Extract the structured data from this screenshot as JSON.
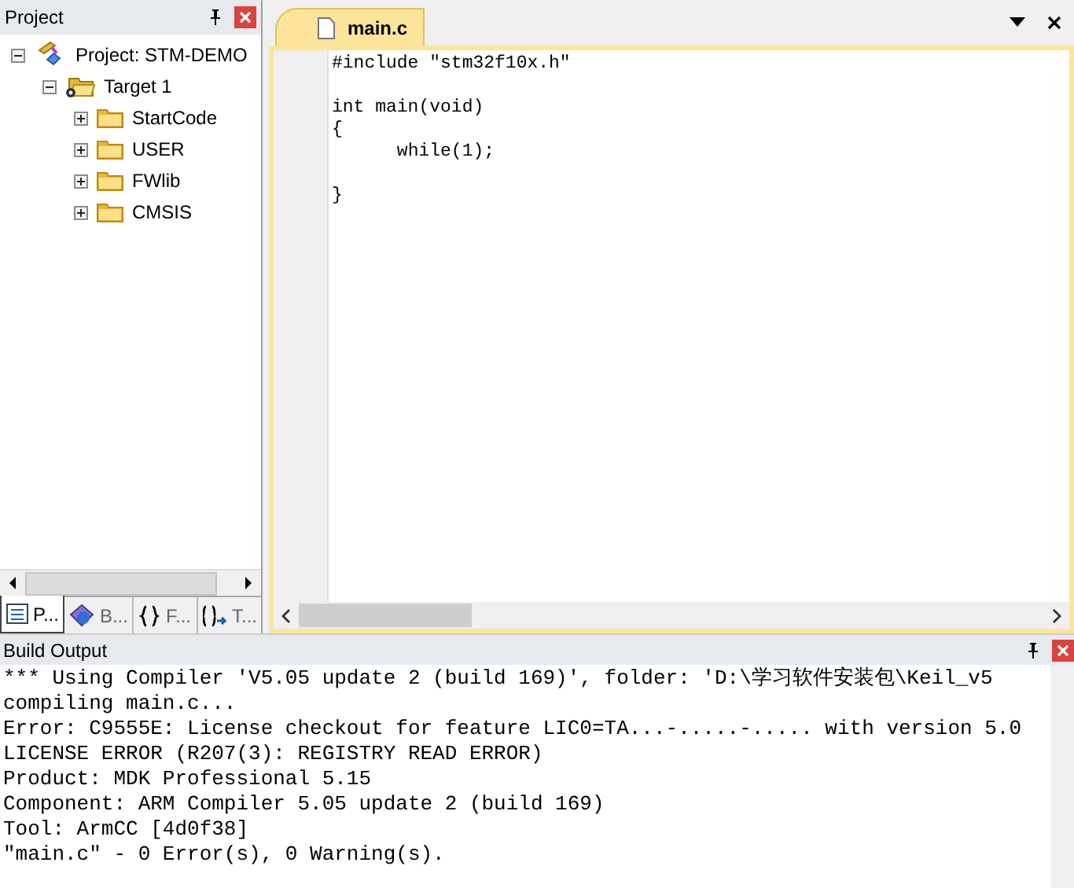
{
  "project_panel": {
    "title": "Project",
    "tree": [
      {
        "label": "Project: STM-DEMO",
        "kind": "project",
        "expanded": true,
        "children": [
          {
            "label": "Target 1",
            "kind": "target",
            "expanded": true,
            "children": [
              {
                "label": "StartCode",
                "kind": "folder",
                "expanded": false
              },
              {
                "label": "USER",
                "kind": "folder",
                "expanded": false
              },
              {
                "label": "FWlib",
                "kind": "folder",
                "expanded": false
              },
              {
                "label": "CMSIS",
                "kind": "folder",
                "expanded": false
              }
            ]
          }
        ]
      }
    ],
    "tabs": [
      {
        "label": "P...",
        "kind": "project",
        "selected": true
      },
      {
        "label": "B...",
        "kind": "books",
        "selected": false
      },
      {
        "label": "F...",
        "kind": "functions",
        "selected": false
      },
      {
        "label": "T...",
        "kind": "templates",
        "selected": false
      }
    ]
  },
  "editor": {
    "tabs": [
      {
        "label": "main.c",
        "selected": true
      }
    ],
    "code_blocks": [
      [
        "#include \"stm32f10x.h\""
      ],
      [
        "int main(void)",
        "{",
        "\twhile(1);"
      ],
      [
        "}"
      ]
    ]
  },
  "build_output": {
    "title": "Build Output",
    "lines": [
      "*** Using Compiler 'V5.05 update 2 (build 169)', folder: 'D:\\学习软件安装包\\Keil_v5",
      "compiling main.c...",
      "Error: C9555E: License checkout for feature LIC0=TA...-.....-..... with version 5.0",
      "LICENSE ERROR (R207(3): REGISTRY READ ERROR)",
      "Product: MDK Professional 5.15",
      "Component: ARM Compiler 5.05 update 2 (build 169)",
      "Tool: ArmCC [4d0f38]",
      "\"main.c\" - 0 Error(s), 0 Warning(s)."
    ]
  }
}
